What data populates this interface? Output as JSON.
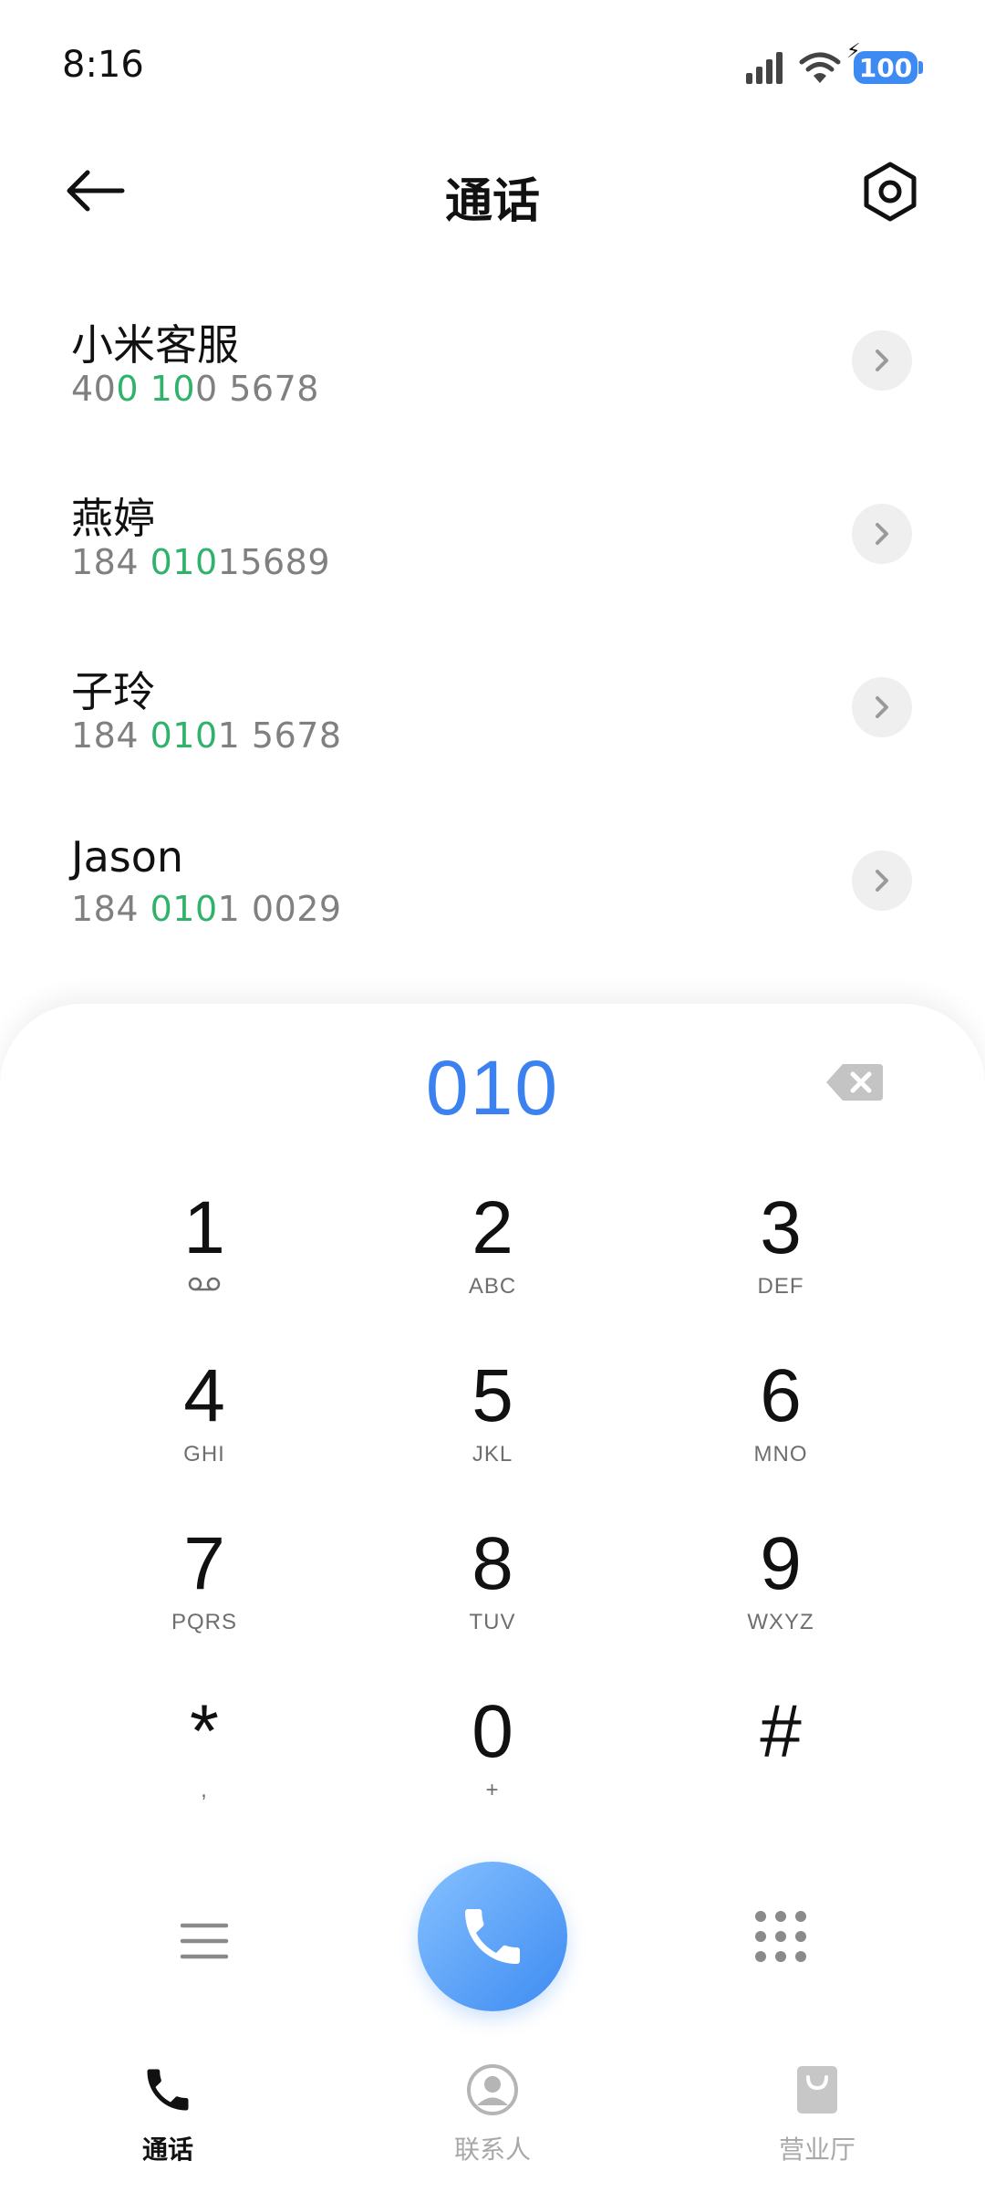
{
  "status_bar": {
    "time": "8:16",
    "battery": "100"
  },
  "header": {
    "title": "通话"
  },
  "contacts": [
    {
      "name": "小米客服",
      "number_segments": [
        {
          "text": "40",
          "hl": false
        },
        {
          "text": "0",
          "hl": true
        },
        {
          "text": " ",
          "hl": false
        },
        {
          "text": "10",
          "hl": true
        },
        {
          "text": "0 5678",
          "hl": false
        }
      ]
    },
    {
      "name": "燕婷",
      "number_segments": [
        {
          "text": "184 ",
          "hl": false
        },
        {
          "text": "010",
          "hl": true
        },
        {
          "text": "15689",
          "hl": false
        }
      ]
    },
    {
      "name": "子玲",
      "number_segments": [
        {
          "text": "184 ",
          "hl": false
        },
        {
          "text": "010",
          "hl": true
        },
        {
          "text": "1 5678",
          "hl": false
        }
      ]
    },
    {
      "name": "Jason",
      "number_segments": [
        {
          "text": "184 ",
          "hl": false
        },
        {
          "text": "010",
          "hl": true
        },
        {
          "text": "1 0029",
          "hl": false
        }
      ]
    }
  ],
  "dialpad": {
    "input_value": "010",
    "keys": [
      {
        "digit": "1",
        "letters": "",
        "voicemail": true
      },
      {
        "digit": "2",
        "letters": "ABC"
      },
      {
        "digit": "3",
        "letters": "DEF"
      },
      {
        "digit": "4",
        "letters": "GHI"
      },
      {
        "digit": "5",
        "letters": "JKL"
      },
      {
        "digit": "6",
        "letters": "MNO"
      },
      {
        "digit": "7",
        "letters": "PQRS"
      },
      {
        "digit": "8",
        "letters": "TUV"
      },
      {
        "digit": "9",
        "letters": "WXYZ"
      },
      {
        "digit": "*",
        "letters": ","
      },
      {
        "digit": "0",
        "letters": "+"
      },
      {
        "digit": "#",
        "letters": ""
      }
    ]
  },
  "bottom_nav": [
    {
      "label": "通话",
      "icon": "phone-icon",
      "active": true
    },
    {
      "label": "联系人",
      "icon": "person-icon",
      "active": false
    },
    {
      "label": "营业厅",
      "icon": "shopping-bag-icon",
      "active": false
    }
  ],
  "colors": {
    "accent": "#3b82f0",
    "highlight": "#2fb36a",
    "muted": "#808080"
  }
}
